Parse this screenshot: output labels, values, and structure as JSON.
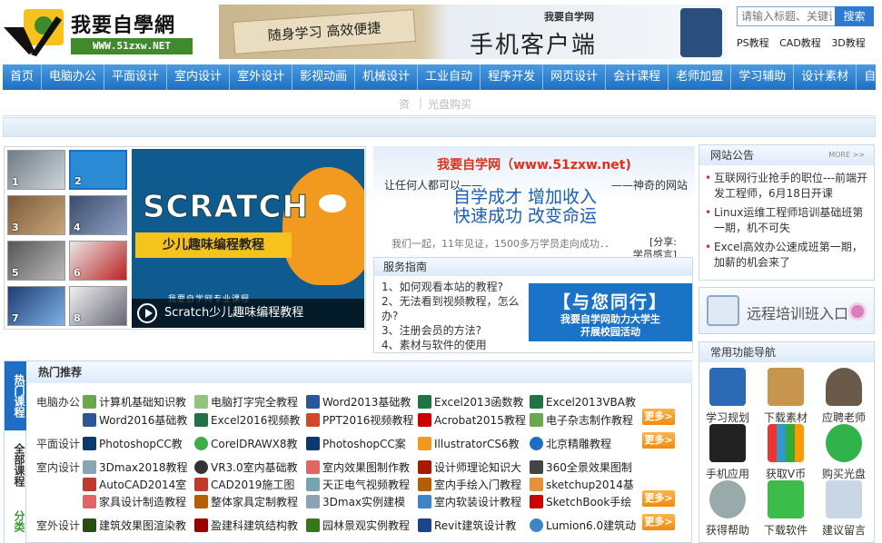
{
  "logo": {
    "title": "我要自學網",
    "url": "WWW.51zxw.NET"
  },
  "banner": {
    "calligraphy": "随身学习 高效便捷",
    "sub": "我要自学网",
    "main": "手机客户端"
  },
  "search": {
    "placeholder": "请输入标题、关键词",
    "button": "搜索",
    "quick_links": [
      "PS教程",
      "CAD教程",
      "3D教程"
    ]
  },
  "nav": [
    "首页",
    "电脑办公",
    "平面设计",
    "室内设计",
    "室外设计",
    "影视动画",
    "机械设计",
    "工业自动",
    "程序开发",
    "网页设计",
    "会计课程",
    "老师加盟",
    "学习辅助",
    "设计素材",
    "自学交"
  ],
  "subnav": [
    "资",
    "光盘购买"
  ],
  "slider": {
    "thumbs": [
      "1",
      "2",
      "3",
      "4",
      "5",
      "6",
      "7",
      "8"
    ],
    "caption": "Scratch少儿趣味编程教程",
    "title_text": "SCRATCH",
    "banner_text": "少儿趣味编程教程",
    "course_text": "我要自学网专业课程"
  },
  "intro": {
    "site": "我要自学网（www.51zxw.net)",
    "line1": "让任何人都可以——",
    "line1b": "——神奇的网站",
    "slogan1": "自学成才  增加收入",
    "slogan2": "快速成功  改变命运",
    "line3": "我们一起，11年见证，1500多万学员走向成功．．",
    "share1": "[分享:",
    "share2": "学员感言]"
  },
  "service": {
    "title": "服务指南",
    "items": [
      "1、如何观看本站的教程?",
      "2、无法看到视频教程，怎么办?",
      "3、注册会员的方法?",
      "4、素材与软件的使用"
    ],
    "ad_big": "【与您同行】",
    "ad_small1": "我要自学网助力大学生",
    "ad_small2": "开展校园活动"
  },
  "notice": {
    "title": "网站公告",
    "more": "MORE >>",
    "items": [
      "互联网行业抢手的职位---前端开发工程师，6月18日开课",
      "Linux运维工程师培训基础班第一期，机不可失",
      "Excel高效办公速成班第一期，加薪的机会来了"
    ]
  },
  "training": {
    "label": "远程培训班入口"
  },
  "funcnav": {
    "title": "常用功能导航",
    "items": [
      "学习规划",
      "下载素材",
      "应聘老师",
      "手机应用",
      "获取V币",
      "购买光盘",
      "获得帮助",
      "下载软件",
      "建议留言"
    ]
  },
  "hot": {
    "title": "热门推荐",
    "tabs": [
      "热门课程",
      "全部课程",
      "分类"
    ],
    "more": "更多>",
    "categories": [
      "电脑办公",
      "平面设计",
      "室内设计",
      "室外设计"
    ],
    "rows": [
      [
        "计算机基础知识教",
        "电脑打字完全教程",
        "Word2013基础教",
        "Excel2013函数教",
        "Excel2013VBA教"
      ],
      [
        "Word2016基础教",
        "Excel2016视频教",
        "PPT2016视频教程",
        "Acrobat2015教程",
        "电子杂志制作教程"
      ],
      [
        "PhotoshopCC教",
        "CorelDRAWX8教",
        "PhotoshopCC案",
        "IllustratorCS6教",
        "北京精雕教程"
      ],
      [
        "3Dmax2018教程",
        "VR3.0室内基础教",
        "室内效果图制作教",
        "设计师理论知识大",
        "360全景效果图制"
      ],
      [
        "AutoCAD2014室",
        "CAD2019施工图",
        "天正电气视频教程",
        "室内手绘入门教程",
        "sketchup2014基"
      ],
      [
        "家具设计制造教程",
        "整体家具定制教程",
        "3Dmax实例建模",
        "室内软装设计教程",
        "SketchBook手绘"
      ],
      [
        "建筑效果图渲染教",
        "盈建科建筑结构教",
        "园林景观实例教程",
        "Revit建筑设计教",
        "Lumion6.0建筑动"
      ]
    ]
  }
}
